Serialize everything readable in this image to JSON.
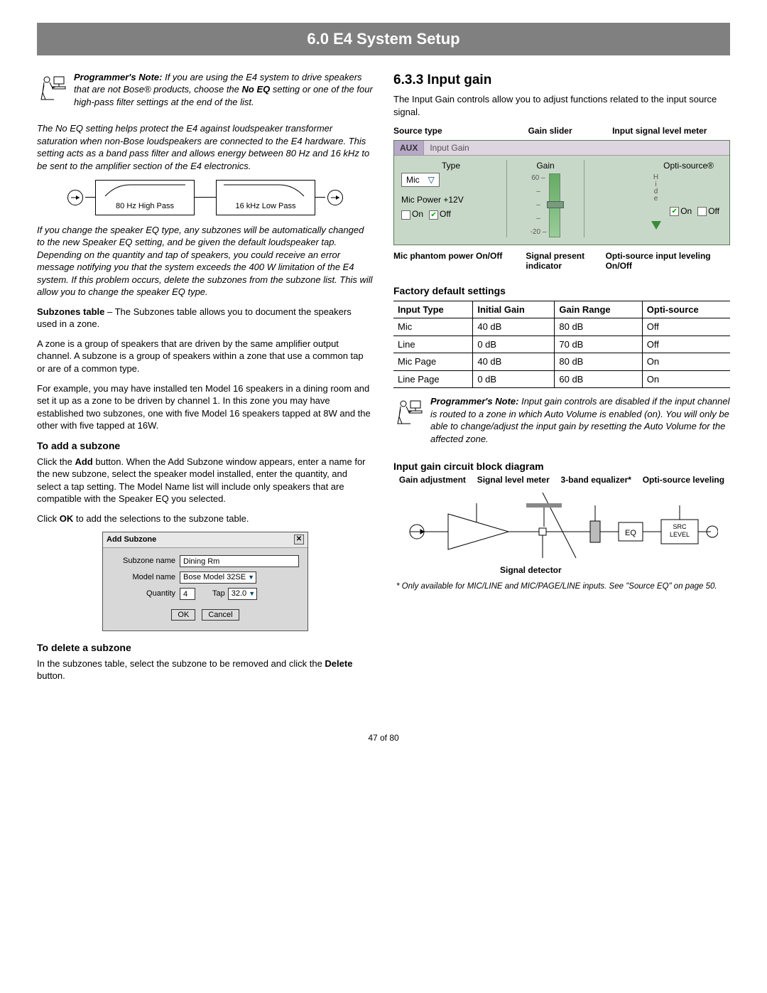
{
  "header": {
    "title": "6.0 E4 System Setup"
  },
  "left": {
    "note1_label": "Programmer's Note:",
    "note1_text": " If you are using the E4 system to drive speakers that are not Bose® products, choose the ",
    "note1_bold": "No EQ",
    "note1_text2": " setting or one of the four high-pass filter settings at the end of the list.",
    "noeq_para": "The No EQ setting helps protect the E4 against loudspeaker transformer saturation when non-Bose loudspeakers are connected to the E4 hardware. This setting acts as a band pass filter and allows energy between 80 Hz and 16 kHz to be sent to the amplifier section of the E4 electronics.",
    "filter1": "80 Hz High Pass",
    "filter2": "16 kHz Low Pass",
    "changeeq_para": "If you change the speaker EQ type, any subzones will be automatically changed to the new Speaker EQ setting, and be given the default loudspeaker tap. Depending on the quantity and tap of speakers, you could receive an error message notifying you that the system exceeds the 400 W limitation of the E4 system. If this problem occurs, delete the subzones from the subzone list. This will allow you to change the speaker EQ type.",
    "subzones_bold": "Subzones table",
    "subzones_text": " – The Subzones table allows you to document the speakers used in a zone.",
    "zone_para": "A zone is a group of speakers that are driven by the same amplifier output channel. A subzone is a group of speakers within a zone that use a common tap or are of a common type.",
    "example_para": "For example, you may have installed ten Model 16 speakers in a dining room and set it up as a zone to be driven by channel 1. In this zone you may have established two subzones, one with five Model 16 speakers tapped at 8W and the other with five tapped at 16W.",
    "add_heading": "To add a subzone",
    "add_p1a": "Click the ",
    "add_p1b": "Add",
    "add_p1c": " button. When the Add Subzone window appears, enter a name for the new subzone, select the speaker model installed, enter the quantity, and select a tap setting. The Model Name list will include only speakers that are compatible with the Speaker EQ you selected.",
    "add_p2a": "Click ",
    "add_p2b": "OK",
    "add_p2c": " to add the selections to the subzone table.",
    "dlg": {
      "title": "Add Subzone",
      "subzone_label": "Subzone name",
      "subzone_value": "Dining Rm",
      "model_label": "Model name",
      "model_value": "Bose Model 32SE",
      "qty_label": "Quantity",
      "qty_value": "4",
      "tap_label": "Tap",
      "tap_value": "32.0",
      "ok": "OK",
      "cancel": "Cancel"
    },
    "delete_heading": "To delete a subzone",
    "delete_p1a": "In the subzones table, select the subzone to be removed and click the ",
    "delete_p1b": "Delete",
    "delete_p1c": " button."
  },
  "right": {
    "section_heading": "6.3.3 Input gain",
    "intro": "The Input Gain controls allow you to adjust functions related to the input source signal.",
    "top_labels": {
      "source_type": "Source type",
      "gain_slider": "Gain slider",
      "input_meter": "Input signal level meter"
    },
    "panel": {
      "aux": "AUX",
      "title": "Input Gain",
      "type_label": "Type",
      "type_value": "Mic",
      "mic_power": "Mic Power +12V",
      "on": "On",
      "off": "Off",
      "gain_label": "Gain",
      "scale_top": "60",
      "scale_bot": "-20",
      "hide": "Hide",
      "opti": "Opti-source®"
    },
    "bottom_labels": {
      "mic_phantom": "Mic phantom power On/Off",
      "signal_present": "Signal present indicator",
      "opti_onoff": "Opti-source input leveling On/Off"
    },
    "factory_heading": "Factory default settings",
    "table": {
      "headers": [
        "Input Type",
        "Initial Gain",
        "Gain Range",
        "Opti-source"
      ],
      "rows": [
        [
          "Mic",
          "40 dB",
          "80 dB",
          "Off"
        ],
        [
          "Line",
          "0 dB",
          "70 dB",
          "Off"
        ],
        [
          "Mic Page",
          "40 dB",
          "80 dB",
          "On"
        ],
        [
          "Line Page",
          "0 dB",
          "60 dB",
          "On"
        ]
      ]
    },
    "note2_label": "Programmer's Note:",
    "note2_text": " Input gain controls are disabled if the input channel is routed to a zone in which Auto Volume is enabled (on). You will only be able to change/adjust the input gain by resetting the Auto Volume for the affected zone.",
    "block_heading": "Input gain circuit block diagram",
    "bd_labels": {
      "gain": "Gain adjustment",
      "signal": "Signal level meter",
      "eq3": "3-band equalizer*",
      "opti": "Opti-source leveling"
    },
    "bd_eq": "EQ",
    "bd_src": "SRC LEVEL",
    "bd_sigdet": "Signal detector",
    "footnote": "* Only available for MIC/LINE and MIC/PAGE/LINE inputs. See \"Source EQ\" on page 50."
  },
  "footer": {
    "page": "47 of 80"
  }
}
